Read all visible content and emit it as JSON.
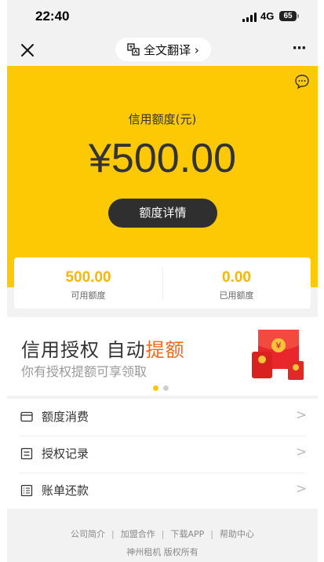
{
  "status_bar": {
    "time": "22:40",
    "network": "4G",
    "battery": "65"
  },
  "nav": {
    "translate_label": "全文翻译 ›",
    "more_label": "···"
  },
  "hero": {
    "credit_label": "信用额度(元)",
    "credit_amount": "¥500.00",
    "detail_button": "额度详情"
  },
  "quota": {
    "available_value": "500.00",
    "available_label": "可用额度",
    "used_value": "0.00",
    "used_label": "已用额度"
  },
  "banner": {
    "title_part1": "信用授权 自动",
    "title_highlight": "提额",
    "subtitle": "你有授权提额可享领取",
    "carousel_active_index": 0
  },
  "menu": {
    "items": [
      {
        "label": "额度消费",
        "icon": "card-icon",
        "arrow": ">"
      },
      {
        "label": "授权记录",
        "icon": "list-icon",
        "arrow": ">"
      },
      {
        "label": "账单还款",
        "icon": "bill-icon",
        "arrow": ">"
      }
    ]
  },
  "footer": {
    "links": [
      "公司简介",
      "加盟合作",
      "下载APP",
      "帮助中心"
    ],
    "link_separator": "|",
    "copyright": "神州租机 版权所有"
  },
  "colors": {
    "brand_yellow": "#fdc804",
    "accent_orange": "#f06a1c",
    "quota_gold": "#f5b60e",
    "button_dark": "#2f2f2f"
  }
}
